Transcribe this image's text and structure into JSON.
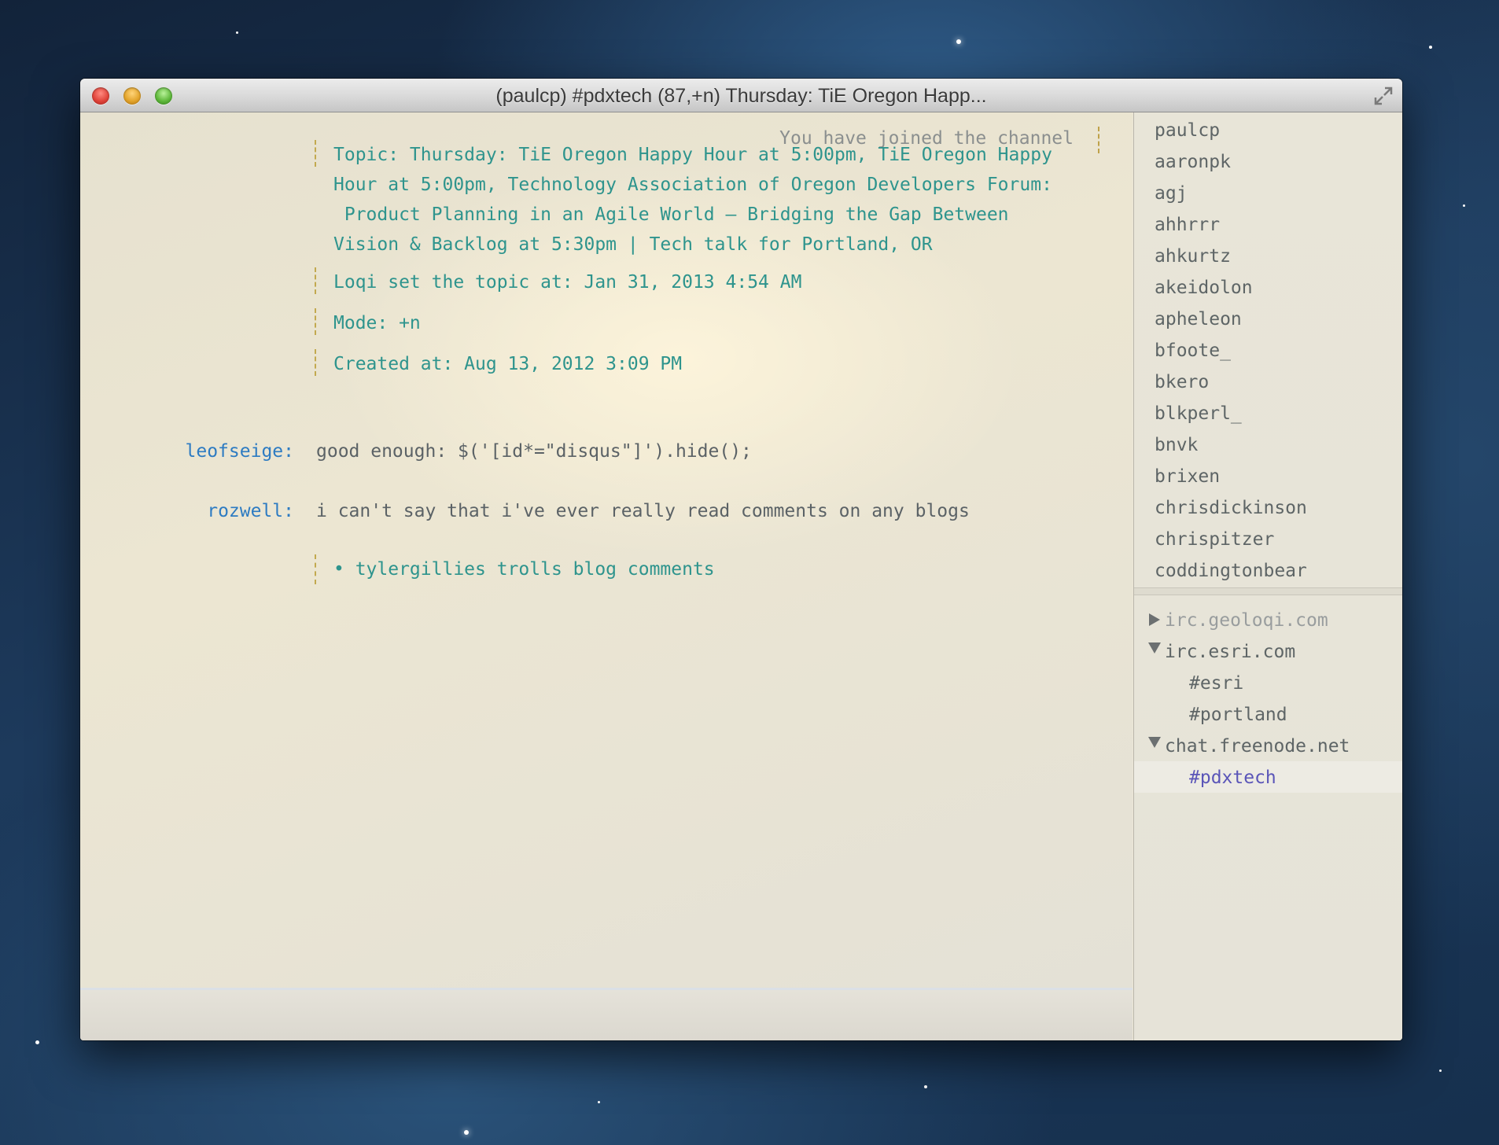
{
  "window": {
    "title": "(paulcp) #pdxtech (87,+n) Thursday: TiE Oregon Happ..."
  },
  "chat": {
    "joined_notice": "You have joined the channel",
    "topic_lines": [
      "Topic: Thursday: TiE Oregon Happy Hour at 5:00pm, TiE Oregon Happy",
      "Hour at 5:00pm, Technology Association of Oregon Developers Forum:",
      " Product Planning in an Agile World – Bridging the Gap Between",
      "Vision & Backlog at 5:30pm | Tech talk for Portland, OR"
    ],
    "topic_set": "Loqi set the topic at: Jan 31, 2013 4:54 AM",
    "mode": "Mode: +n",
    "created": "Created at: Aug 13, 2012 3:09 PM",
    "messages": [
      {
        "nick": "leofseige:",
        "text": "good enough: $('[id*=\"disqus\"]').hide();"
      },
      {
        "nick": "rozwell:",
        "text": "i can't say that i've ever really read comments on any blogs"
      }
    ],
    "action": "• tylergillies trolls blog comments"
  },
  "users": [
    "paulcp",
    "aaronpk",
    "agj",
    "ahhrrr",
    "ahkurtz",
    "akeidolon",
    "apheleon",
    "bfoote_",
    "bkero",
    "blkperl_",
    "bnvk",
    "brixen",
    "chrisdickinson",
    "chrispitzer",
    "coddingtonbear"
  ],
  "servers": [
    {
      "name": "irc.geoloqi.com",
      "expanded": false,
      "channels": []
    },
    {
      "name": "irc.esri.com",
      "expanded": true,
      "channels": [
        "#esri",
        "#portland"
      ]
    },
    {
      "name": "chat.freenode.net",
      "expanded": true,
      "channels": [
        "#pdxtech"
      ]
    }
  ],
  "colors": {
    "topic_text": "#2e948d",
    "nick": "#2d7bc2",
    "action": "#c08a1f",
    "selected_channel": "#5a55b8",
    "collapsed_server": "#999d9e"
  }
}
